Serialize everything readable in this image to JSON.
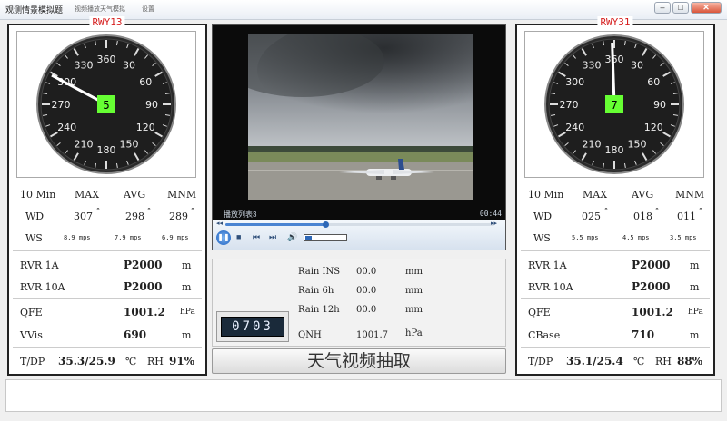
{
  "window": {
    "title": "观测情景模拟题",
    "menu": [
      "视频播放天气模拟",
      "设置"
    ],
    "buttons": {
      "minimize": "–",
      "maximize": "□",
      "close": "✕"
    }
  },
  "left": {
    "runway": "RWY13",
    "dial": {
      "labels": [
        "300",
        "330",
        "360",
        "30",
        "60",
        "90",
        "120",
        "150",
        "180",
        "210",
        "240",
        "270"
      ],
      "wind_dir_deg": 298,
      "wind_speed": "5"
    },
    "header": {
      "period": "10 Min",
      "max": "MAX",
      "avg": "AVG",
      "min": "MNM"
    },
    "wd": {
      "label": "WD",
      "max": "307",
      "avg": "298",
      "min": "289"
    },
    "ws": {
      "label": "WS",
      "max": "8.9 mps",
      "avg": "7.9 mps",
      "min": "6.9 mps"
    },
    "rvr1a": {
      "label": "RVR 1A",
      "value": "P2000",
      "unit": "m"
    },
    "rvr10a": {
      "label": "RVR 10A",
      "value": "P2000",
      "unit": "m"
    },
    "qfe": {
      "label": "QFE",
      "value": "1001.2",
      "unit": "hPa"
    },
    "extra": {
      "label": "VVis",
      "value": "690",
      "unit": "m"
    },
    "tdp": {
      "label": "T/DP",
      "value": "35.3/25.9",
      "unit": "℃",
      "rh_label": "RH",
      "rh_value": "91%"
    }
  },
  "right": {
    "runway": "RWY31",
    "dial": {
      "labels": [
        "300",
        "330",
        "360",
        "30",
        "60",
        "90",
        "120",
        "150",
        "180",
        "210",
        "240",
        "270"
      ],
      "wind_dir_deg": 358,
      "wind_speed": "7"
    },
    "header": {
      "period": "10 Min",
      "max": "MAX",
      "avg": "AVG",
      "min": "MNM"
    },
    "wd": {
      "label": "WD",
      "max": "025",
      "avg": "018",
      "min": "011"
    },
    "ws": {
      "label": "WS",
      "max": "5.5 mps",
      "avg": "4.5 mps",
      "min": "3.5 mps"
    },
    "rvr1a": {
      "label": "RVR 1A",
      "value": "P2000",
      "unit": "m"
    },
    "rvr10a": {
      "label": "RVR 10A",
      "value": "P2000",
      "unit": "m"
    },
    "qfe": {
      "label": "QFE",
      "value": "1001.2",
      "unit": "hPa"
    },
    "extra": {
      "label": "CBase",
      "value": "710",
      "unit": "m"
    },
    "tdp": {
      "label": "T/DP",
      "value": "35.1/25.4",
      "unit": "℃",
      "rh_label": "RH",
      "rh_value": "88%"
    }
  },
  "video": {
    "playlist_label": "播放列表3",
    "time": "00:44",
    "progress": 0.37,
    "volume": 0.15
  },
  "rain": {
    "ins": {
      "label": "Rain INS",
      "value": "00.0",
      "unit": "mm"
    },
    "h6": {
      "label": "Rain 6h",
      "value": "00.0",
      "unit": "mm"
    },
    "h12": {
      "label": "Rain 12h",
      "value": "00.0",
      "unit": "mm"
    },
    "qnh": {
      "label": "QNH",
      "value": "1001.7",
      "unit": "hPa"
    }
  },
  "clock": "0703",
  "extract_button": "天气视频抽取",
  "colors": {
    "runway_label": "#d61f1f",
    "speed_box": "#66ff33",
    "dial_face": "#1e1e1e"
  }
}
